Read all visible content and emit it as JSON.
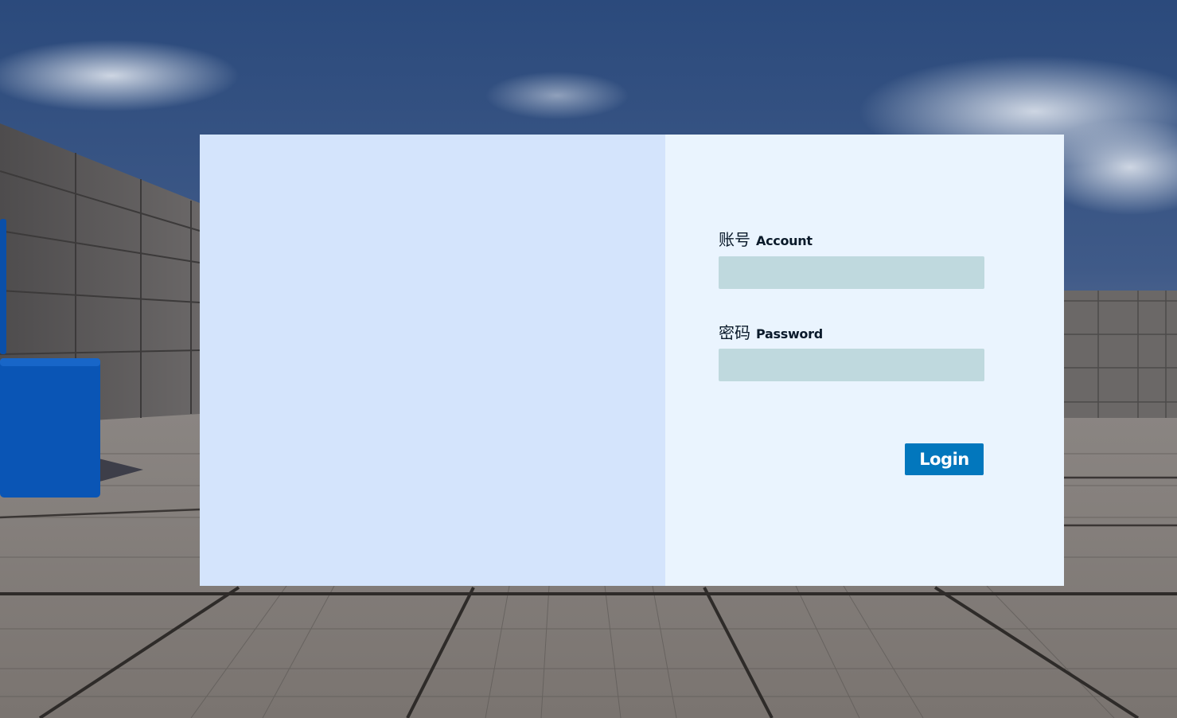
{
  "login": {
    "account": {
      "label_zh": "账号",
      "label_en": "Account",
      "value": ""
    },
    "password": {
      "label_zh": "密码",
      "label_en": "Password",
      "value": ""
    },
    "button_label": "Login"
  },
  "colors": {
    "panel_left": "#d4e4fc",
    "panel_right": "#eaf4fe",
    "input_bg": "#bfd9de",
    "button_bg": "#0277bd",
    "label_text": "#0a1a2a",
    "sky_top": "#2f4d7e",
    "sky_bottom": "#5a6f96",
    "floor": "#7d7773",
    "wall": "#5c5a5a",
    "cube": "#0a55b5"
  }
}
